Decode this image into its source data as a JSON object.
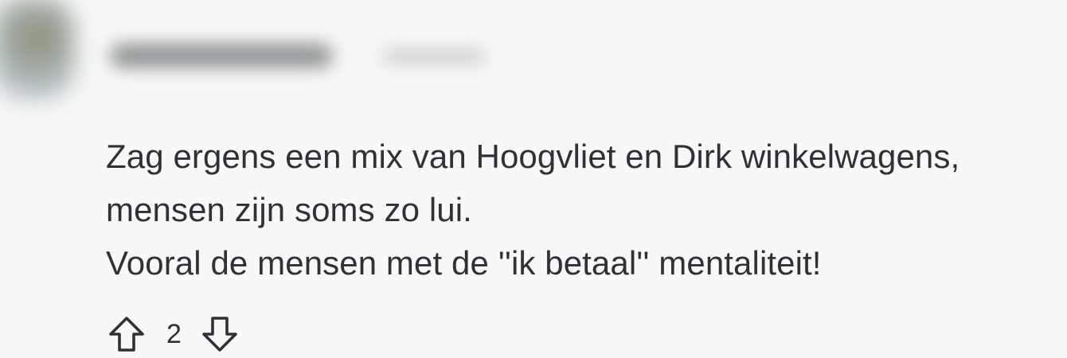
{
  "comment": {
    "author": "",
    "timestamp": "",
    "body_lines": [
      "Zag ergens een mix van Hoogvliet en Dirk winkelwagens,",
      "mensen zijn soms zo lui.",
      "Vooral de mensen met de ''ik betaal'' mentaliteit!"
    ],
    "score": "2"
  },
  "icons": {
    "avatar": "avatar-blurred",
    "upvote": "arrow-up-outline-icon",
    "downvote": "arrow-down-outline-icon"
  },
  "colors": {
    "background": "#f8f8f8",
    "text": "#2e3236"
  }
}
